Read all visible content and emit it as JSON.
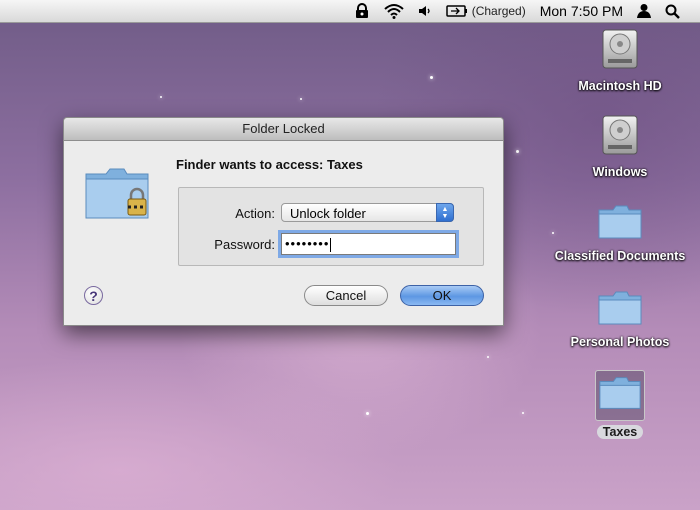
{
  "menubar": {
    "battery_status": "(Charged)",
    "clock": "Mon 7:50 PM",
    "icons": [
      "lock-icon",
      "wifi-icon",
      "volume-icon",
      "battery-icon",
      "user-icon",
      "spotlight-icon"
    ]
  },
  "desktop": {
    "items": [
      {
        "label": "Macintosh HD",
        "icon": "hard-drive-icon"
      },
      {
        "label": "Windows",
        "icon": "hard-drive-icon"
      },
      {
        "label": "Classified Documents",
        "icon": "folder-icon"
      },
      {
        "label": "Personal Photos",
        "icon": "folder-icon"
      },
      {
        "label": "Taxes",
        "icon": "folder-icon",
        "selected": true
      }
    ]
  },
  "dialog": {
    "title": "Folder Locked",
    "prompt": "Finder wants to access: Taxes",
    "action_label": "Action:",
    "action_value": "Unlock folder",
    "password_label": "Password:",
    "password_value": "••••••••",
    "help_label": "?",
    "cancel_label": "Cancel",
    "ok_label": "OK"
  },
  "colors": {
    "accent": "#5d97e3",
    "folder": "#9cc3e6"
  }
}
